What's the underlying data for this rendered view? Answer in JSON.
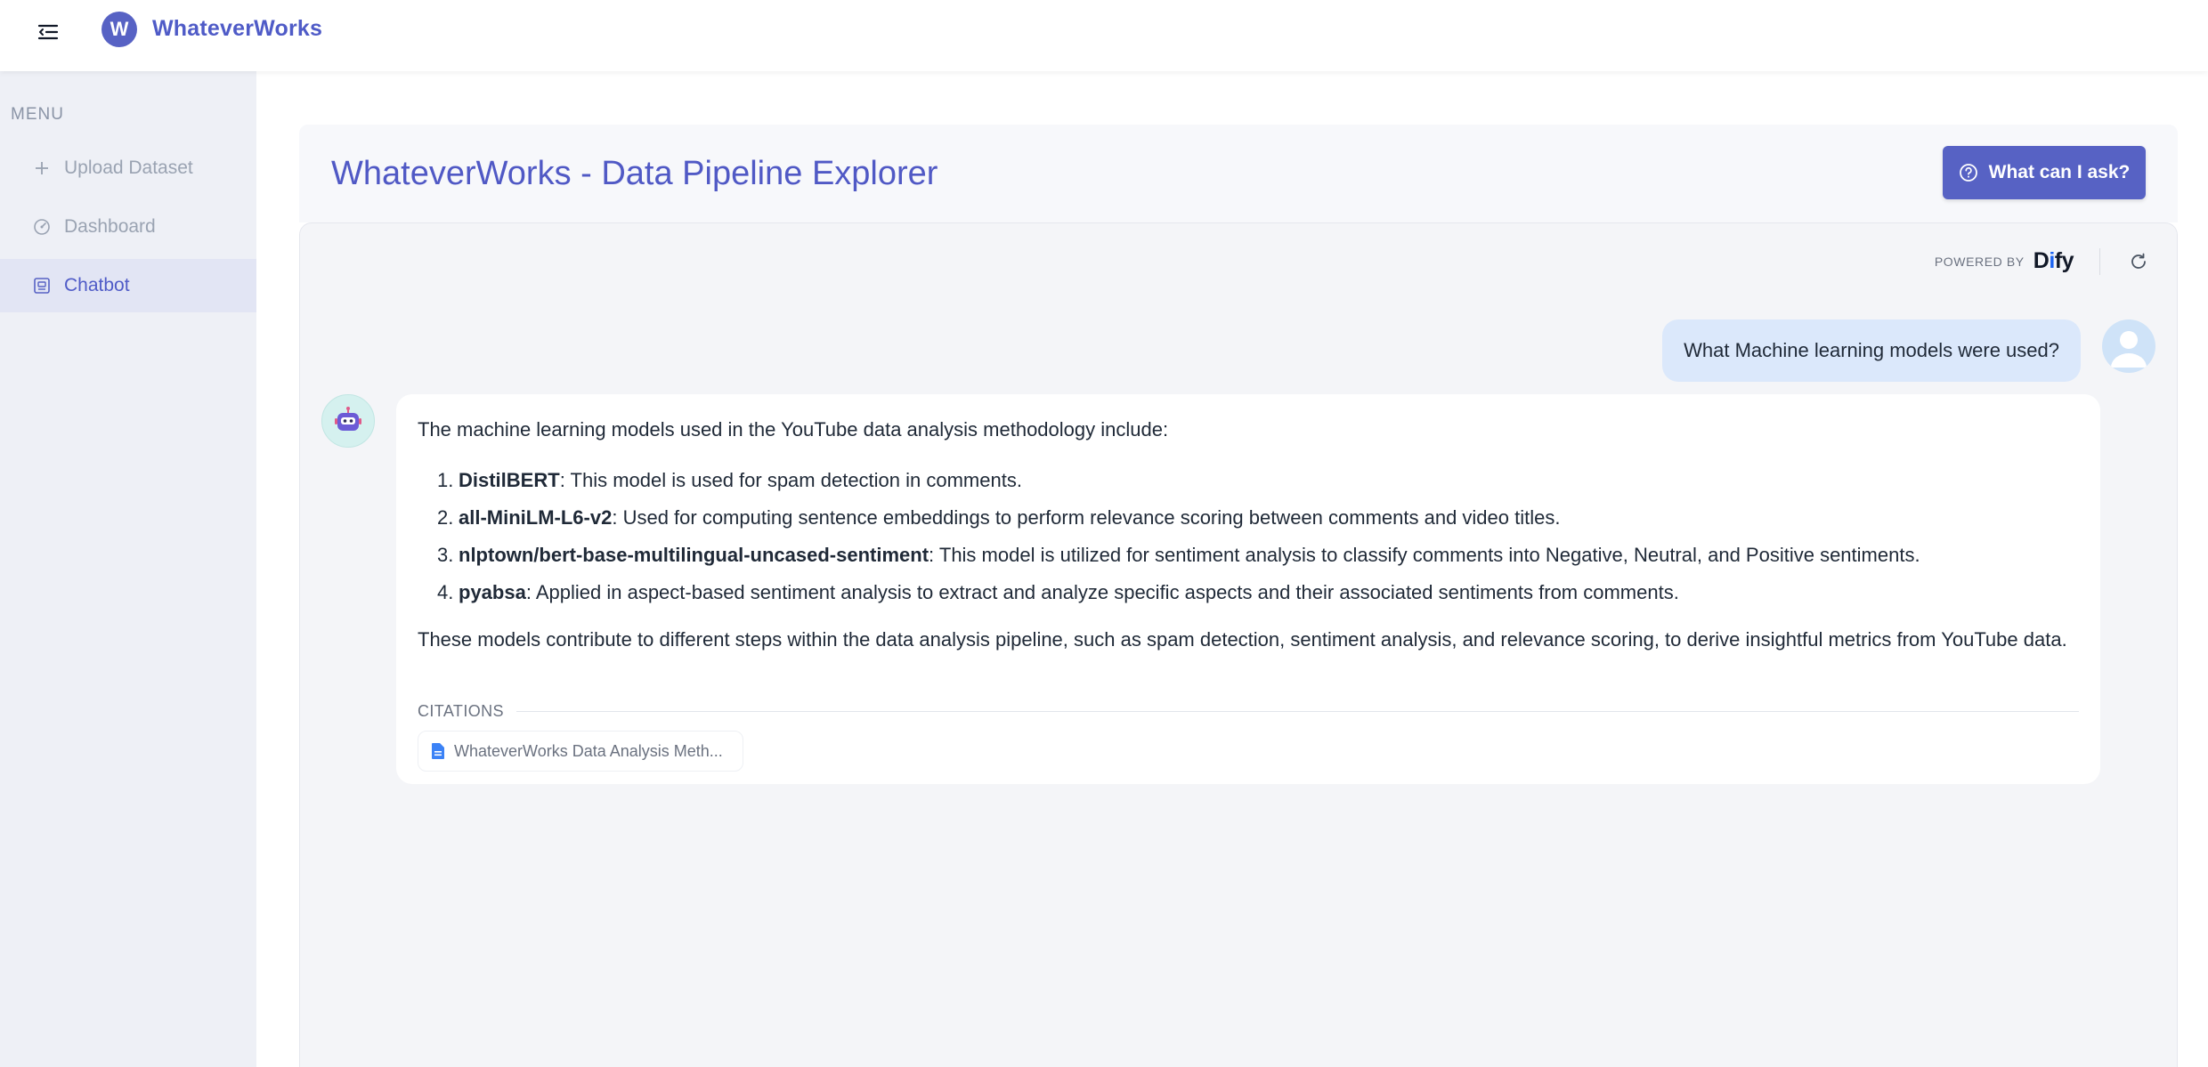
{
  "header": {
    "logo_letter": "W",
    "brand": "WhateverWorks"
  },
  "sidebar": {
    "heading": "MENU",
    "items": [
      {
        "label": "Upload Dataset",
        "icon": "plus-icon",
        "active": false
      },
      {
        "label": "Dashboard",
        "icon": "gauge-icon",
        "active": false
      },
      {
        "label": "Chatbot",
        "icon": "chatbot-icon",
        "active": true
      }
    ]
  },
  "main": {
    "title": "WhateverWorks - Data Pipeline Explorer",
    "ask_button": "What can I ask?"
  },
  "chat": {
    "powered_by": "POWERED BY",
    "powered_brand_a": "D",
    "powered_brand_b": "i",
    "powered_brand_c": "fy",
    "user_message": "What Machine learning models were used?",
    "bot_intro": "The machine learning models used in the YouTube data analysis methodology include:",
    "models": [
      {
        "num": "1.",
        "name": "DistilBERT",
        "desc": ": This model is used for spam detection in comments."
      },
      {
        "num": "2.",
        "name": "all-MiniLM-L6-v2",
        "desc": ": Used for computing sentence embeddings to perform relevance scoring between comments and video titles."
      },
      {
        "num": "3.",
        "name": "nlptown/bert-base-multilingual-uncased-sentiment",
        "desc": ": This model is utilized for sentiment analysis to classify comments into Negative, Neutral, and Positive sentiments."
      },
      {
        "num": "4.",
        "name": "pyabsa",
        "desc": ": Applied in aspect-based sentiment analysis to extract and analyze specific aspects and their associated sentiments from comments."
      }
    ],
    "bot_outro": "These models contribute to different steps within the data analysis pipeline, such as spam detection, sentiment analysis, and relevance scoring, to derive insightful metrics from YouTube data.",
    "citations_label": "CITATIONS",
    "citation": "WhateverWorks Data Analysis Meth..."
  },
  "colors": {
    "accent": "#5762c4",
    "brand_text": "#4f5bc7",
    "user_bubble": "#dbe8fb"
  }
}
